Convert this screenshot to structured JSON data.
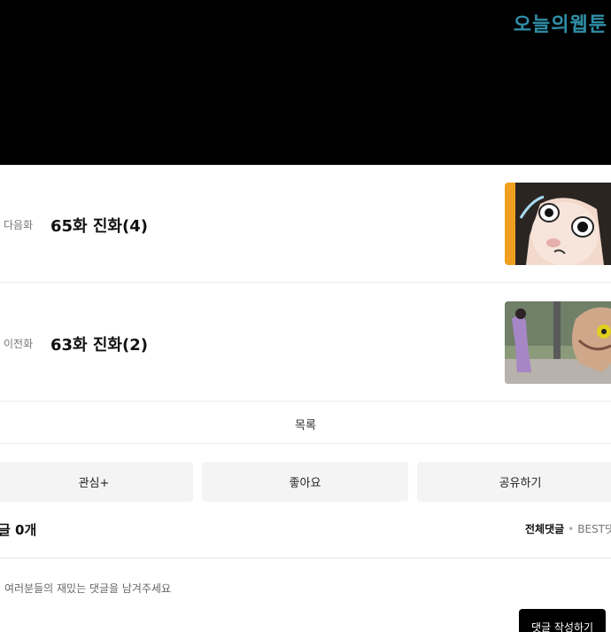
{
  "banner": {
    "logo_text": "오늘의웹툰"
  },
  "next_episode": {
    "label": "다음화",
    "title": "65화 진화(4)"
  },
  "prev_episode": {
    "label": "이전화",
    "title": "63화 진화(2)"
  },
  "list": {
    "label": "목록"
  },
  "actions": {
    "follow": "관심+",
    "like": "좋아요",
    "share": "공유하기"
  },
  "comments": {
    "count_label": "글 0개",
    "tab_all": "전체댓글",
    "tab_separator": "•",
    "tab_best": "BEST댓",
    "placeholder": "여러분들의 재밌는 댓글을 남겨주세요",
    "write_button": "댓글 작성하기"
  },
  "colors": {
    "logo": "#2f8fa8",
    "button_bg": "#f4f4f4",
    "write_button_bg": "#000000"
  }
}
